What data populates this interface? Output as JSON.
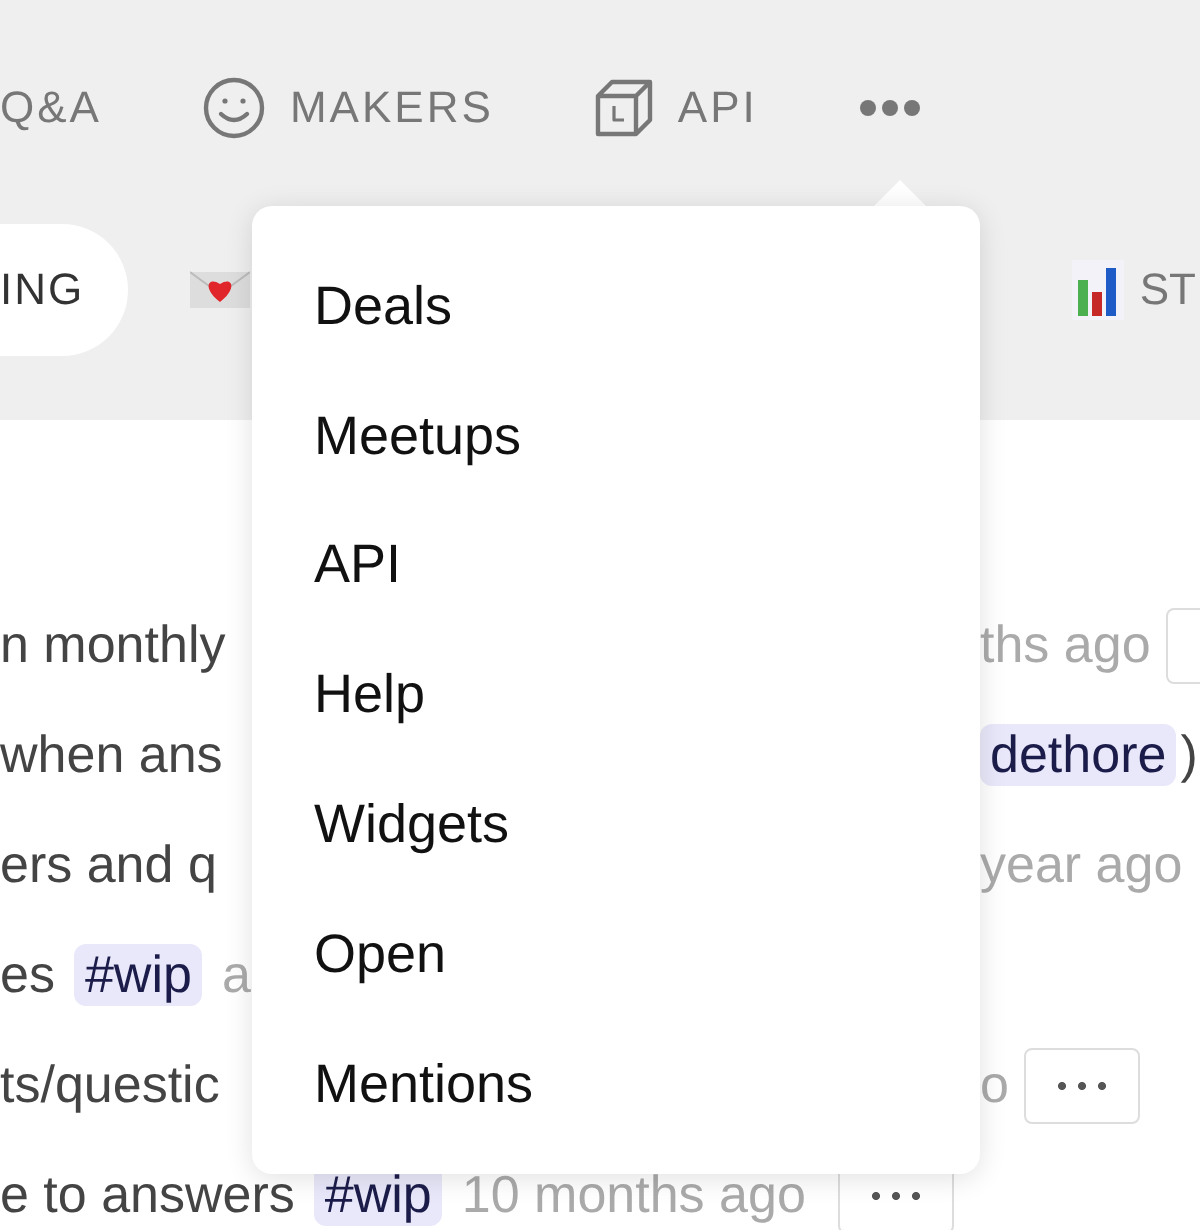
{
  "nav": {
    "items": [
      {
        "label": "Q&A"
      },
      {
        "label": "MAKERS"
      },
      {
        "label": "API"
      }
    ]
  },
  "subnav": {
    "pill": "ING",
    "stats_label": "ST"
  },
  "rows": [
    {
      "left": [
        {
          "kind": "text",
          "text": "n monthly"
        }
      ],
      "right": [
        {
          "kind": "time",
          "text": "ths ago"
        }
      ],
      "menu_button": true
    },
    {
      "left": [
        {
          "kind": "text",
          "text": "when ans"
        }
      ],
      "right": [
        {
          "kind": "tag",
          "text": "dethore"
        },
        {
          "kind": "text",
          "text": ")"
        }
      ],
      "menu_button": false
    },
    {
      "left": [
        {
          "kind": "text",
          "text": "ers and q"
        }
      ],
      "right": [
        {
          "kind": "time",
          "text": "year ago"
        }
      ],
      "menu_button": false
    },
    {
      "left": [
        {
          "kind": "text",
          "text": "es"
        },
        {
          "kind": "tag",
          "text": "#wip"
        },
        {
          "kind": "time",
          "text": "a"
        }
      ],
      "right": [],
      "menu_button": false
    },
    {
      "left": [
        {
          "kind": "text",
          "text": "ts/questic"
        }
      ],
      "right": [
        {
          "kind": "time",
          "text": "o"
        }
      ],
      "menu_button": true
    },
    {
      "left": [
        {
          "kind": "text",
          "text": "e to answers"
        },
        {
          "kind": "tag",
          "text": "#wip"
        },
        {
          "kind": "time",
          "text": "10 months ago"
        }
      ],
      "right": [],
      "menu_button": true
    }
  ],
  "menu": {
    "items": [
      {
        "label": "Deals"
      },
      {
        "label": "Meetups"
      },
      {
        "label": "API"
      },
      {
        "label": "Help"
      },
      {
        "label": "Widgets"
      },
      {
        "label": "Open"
      },
      {
        "label": "Mentions"
      }
    ]
  }
}
